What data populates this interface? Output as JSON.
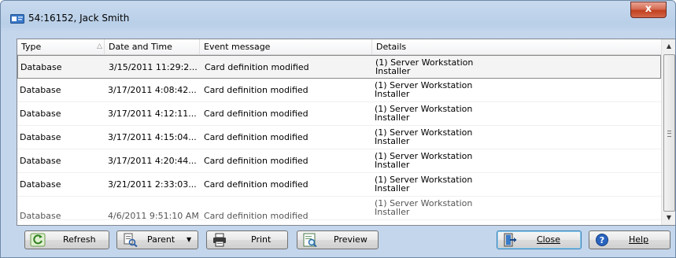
{
  "window": {
    "title": "54:16152, Jack Smith",
    "close_glyph": "x"
  },
  "grid": {
    "columns": [
      {
        "label": "Type"
      },
      {
        "label": "Date and Time"
      },
      {
        "label": "Event message"
      },
      {
        "label": "Details"
      }
    ],
    "sort_indicator": "△",
    "rows": [
      {
        "type": "Database",
        "datetime": "3/15/2011 11:29:2...",
        "message": "Card definition modified",
        "details_line1": "(1) Server Workstation",
        "details_line2": "Installer"
      },
      {
        "type": "Database",
        "datetime": "3/17/2011 4:08:42...",
        "message": "Card definition modified",
        "details_line1": "(1) Server Workstation",
        "details_line2": "Installer"
      },
      {
        "type": "Database",
        "datetime": "3/17/2011 4:12:11...",
        "message": "Card definition modified",
        "details_line1": "(1) Server Workstation",
        "details_line2": "Installer"
      },
      {
        "type": "Database",
        "datetime": "3/17/2011 4:15:04...",
        "message": "Card definition modified",
        "details_line1": "(1) Server Workstation",
        "details_line2": "Installer"
      },
      {
        "type": "Database",
        "datetime": "3/17/2011 4:20:44...",
        "message": "Card definition modified",
        "details_line1": "(1) Server Workstation",
        "details_line2": "Installer"
      },
      {
        "type": "Database",
        "datetime": "3/21/2011 2:33:03...",
        "message": "Card definition modified",
        "details_line1": "(1) Server Workstation",
        "details_line2": "Installer"
      },
      {
        "type": "Database",
        "datetime": "4/6/2011 9:51:10 AM",
        "message": "Card definition modified",
        "details_line1": "(1) Server Workstation",
        "details_line2": "Installer"
      }
    ],
    "selected_row": 0
  },
  "toolbar": {
    "refresh_label": "Refresh",
    "parent_label": "Parent",
    "print_label": "Print",
    "preview_label": "Preview",
    "close_label": "Close",
    "help_label": "Help"
  },
  "icons": {
    "refresh": "refresh-icon",
    "parent": "parent-icon",
    "print": "printer-icon",
    "preview": "preview-icon",
    "close": "exit-door-icon",
    "help": "help-icon",
    "window": "card-icon"
  },
  "colors": {
    "window_frame": "#c3d6ec",
    "close_button": "#c9472b",
    "selected_row_border": "#8a8a8a"
  }
}
